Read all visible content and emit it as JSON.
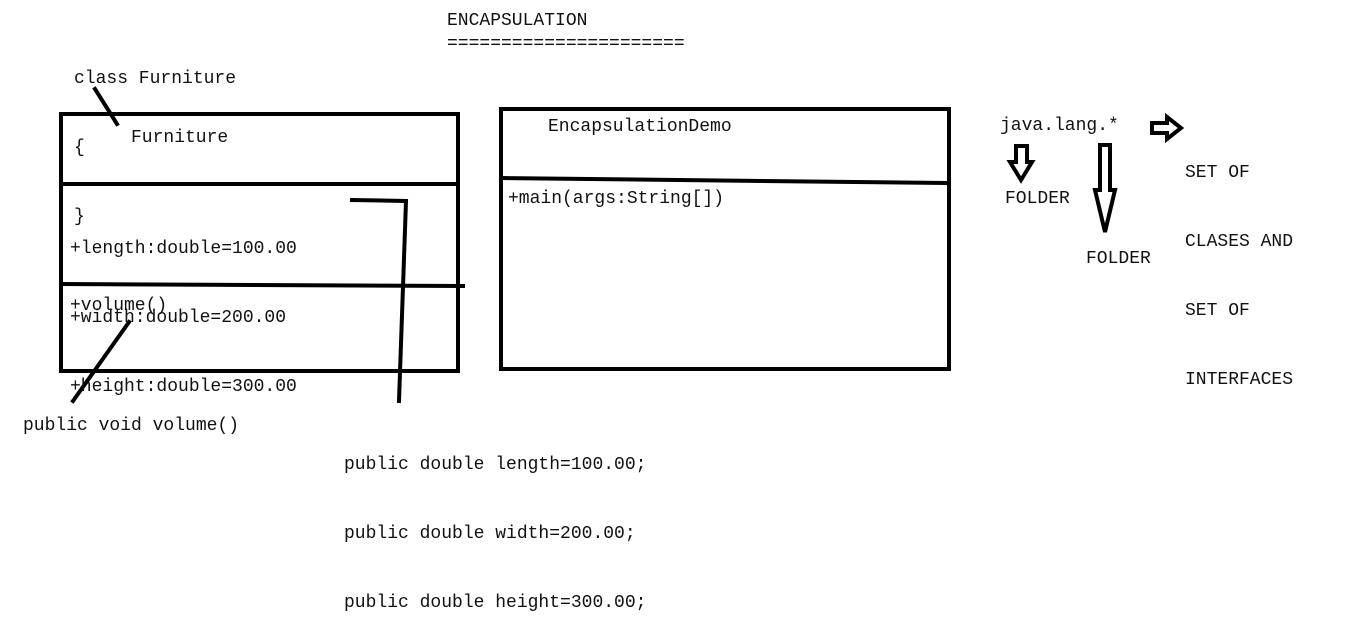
{
  "title": {
    "heading": "ENCAPSULATION",
    "underline": "======================"
  },
  "class_snippet": {
    "lines": [
      "class Furniture",
      "{",
      "}"
    ]
  },
  "furniture_box": {
    "name": "Furniture",
    "attributes": [
      "+length:double=100.00",
      "+width:double=200.00",
      "+height:double=300.00"
    ],
    "methods": [
      "+volume()"
    ]
  },
  "demo_box": {
    "name": "EncapsulationDemo",
    "methods": [
      "+main(args:String[])"
    ]
  },
  "method_note": "public void volume()",
  "field_notes": [
    "public double length=100.00;",
    "public double width=200.00;",
    "public double height=300.00;"
  ],
  "package_note": {
    "package": "java.lang.*",
    "folder_label_1": "FOLDER",
    "folder_label_2": "FOLDER",
    "description": [
      "SET OF",
      "CLASES AND",
      "SET OF",
      "INTERFACES"
    ]
  }
}
